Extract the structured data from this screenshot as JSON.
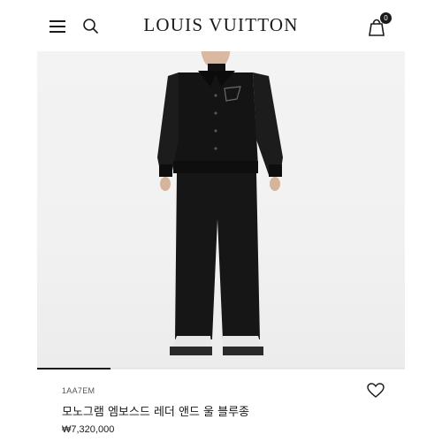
{
  "header": {
    "brand": "LOUIS VUITTON",
    "cart_count": "0",
    "icons": {
      "menu": "hamburger-menu-icon",
      "search": "search-icon",
      "cart": "shopping-bag-icon"
    }
  },
  "product": {
    "sku": "1AA7EM",
    "name": "모노그램 엠보스드 레더 앤드 울 블루종",
    "price": "₩7,320,000",
    "wishlist_icon": "heart-icon",
    "gallery_progress": 0.2
  },
  "colors": {
    "text": "#1a1a1a",
    "background": "#ffffff",
    "image_background": "#f2f2f2"
  }
}
